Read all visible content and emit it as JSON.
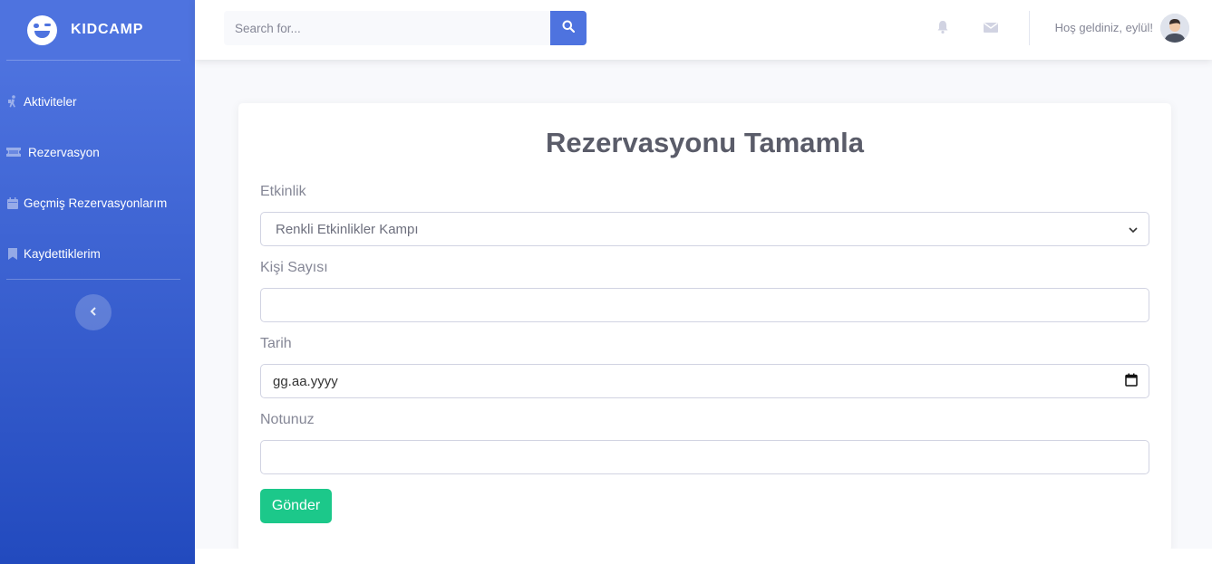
{
  "brand": {
    "name": "KIDCAMP",
    "logo_icon": "winking-face-icon"
  },
  "sidebar": {
    "items": [
      {
        "label": "Aktiviteler",
        "icon": "hiking-icon"
      },
      {
        "label": "Rezervasyon",
        "icon": "ticket-icon"
      },
      {
        "label": "Geçmiş Rezervasyonlarım",
        "icon": "calendar-icon"
      },
      {
        "label": "Kaydettiklerim",
        "icon": "bookmark-icon"
      }
    ],
    "toggle_icon": "chevron-left-icon"
  },
  "topbar": {
    "search": {
      "placeholder": "Search for...",
      "value": ""
    },
    "greeting": "Hoş geldiniz, eylül!",
    "icons": [
      "bell-icon",
      "envelope-icon"
    ]
  },
  "form": {
    "title": "Rezervasyonu Tamamla",
    "fields": {
      "activity": {
        "label": "Etkinlik",
        "value": "Renkli Etkinlikler Kampı"
      },
      "people": {
        "label": "Kişi Sayısı",
        "value": ""
      },
      "date": {
        "label": "Tarih",
        "value": "gg.aa.yyyy"
      },
      "note": {
        "label": "Notunuz",
        "value": ""
      }
    },
    "submit_label": "Gönder"
  },
  "colors": {
    "primary": "#4e73df",
    "success": "#1cc88a",
    "background": "#f8f9fc",
    "text": "#5a5c69"
  }
}
